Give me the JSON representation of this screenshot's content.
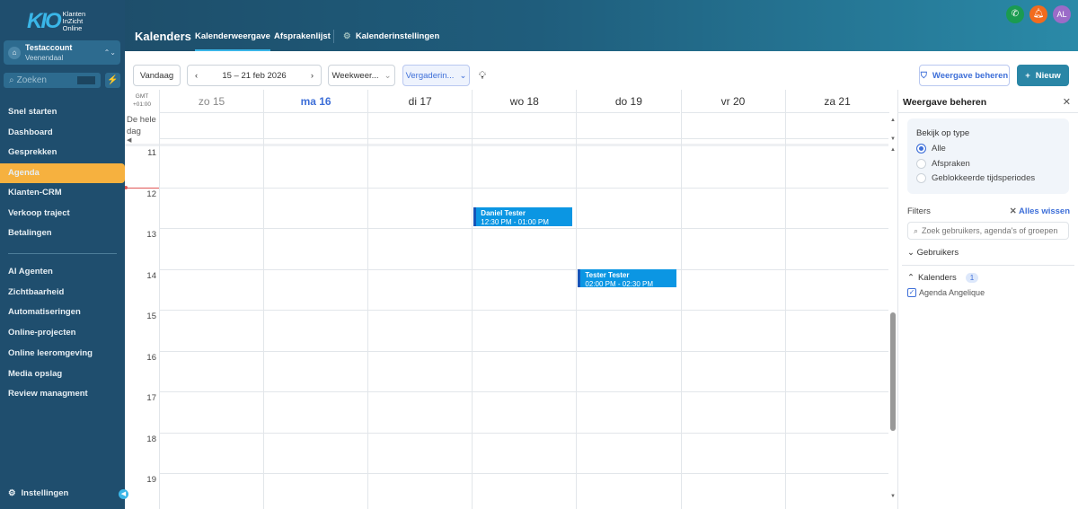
{
  "brand": {
    "mark": "KIO",
    "text": [
      "Klanten",
      "InZicht",
      "Online"
    ]
  },
  "account": {
    "name": "Testaccount",
    "location": "Veenendaal"
  },
  "search": {
    "placeholder": "Zoeken"
  },
  "sidebar": {
    "items": [
      {
        "label": "Snel starten"
      },
      {
        "label": "Dashboard"
      },
      {
        "label": "Gesprekken"
      },
      {
        "label": "Agenda",
        "active": true
      },
      {
        "label": "Klanten-CRM"
      },
      {
        "label": "Verkoop traject"
      },
      {
        "label": "Betalingen"
      }
    ],
    "items2": [
      {
        "label": "AI Agenten"
      },
      {
        "label": "Zichtbaarheid"
      },
      {
        "label": "Automatiseringen"
      },
      {
        "label": "Online-projecten"
      },
      {
        "label": "Online leeromgeving"
      },
      {
        "label": "Media opslag"
      },
      {
        "label": "Review managment"
      }
    ],
    "settings": "Instellingen"
  },
  "header": {
    "title": "Kalenders",
    "tabs": [
      "Kalenderweergave",
      "Afsprakenlijst",
      "Kalenderinstellingen"
    ],
    "avatar": "AL"
  },
  "toolbar": {
    "today": "Vandaag",
    "range": "15 – 21 feb 2026",
    "view": "Weekweer...",
    "type": "Vergaderin...",
    "manage": "Weergave beheren",
    "new": "Nieuw"
  },
  "calendar": {
    "tz": [
      "GMT",
      "+01:00"
    ],
    "allday": "De hele dag",
    "days": [
      "zo 15",
      "ma 16",
      "di 17",
      "wo 18",
      "do 19",
      "vr 20",
      "za 21"
    ],
    "today_index": 1,
    "hours": [
      "11",
      "12",
      "13",
      "14",
      "15",
      "16",
      "17",
      "18",
      "19"
    ],
    "events": [
      {
        "title": "Daniel Tester",
        "time": "12:30 PM - 01:00 PM",
        "day": 3,
        "start": 12.5,
        "end": 13
      },
      {
        "title": "Tester Tester",
        "time": "02:00 PM - 02:30 PM",
        "day": 4,
        "start": 14,
        "end": 14.5
      }
    ],
    "now": 11.9
  },
  "panel": {
    "title": "Weergave beheren",
    "type_label": "Bekijk op type",
    "options": [
      "Alle",
      "Afspraken",
      "Geblokkeerde tijdsperiodes"
    ],
    "selected": 0,
    "filters": "Filters",
    "clear": "Alles wissen",
    "filter_placeholder": "Zoek gebruikers, agenda's of groepen",
    "users": "Gebruikers",
    "calendars": "Kalenders",
    "calendars_count": "1",
    "calendar_item": "Agenda Angelique"
  }
}
